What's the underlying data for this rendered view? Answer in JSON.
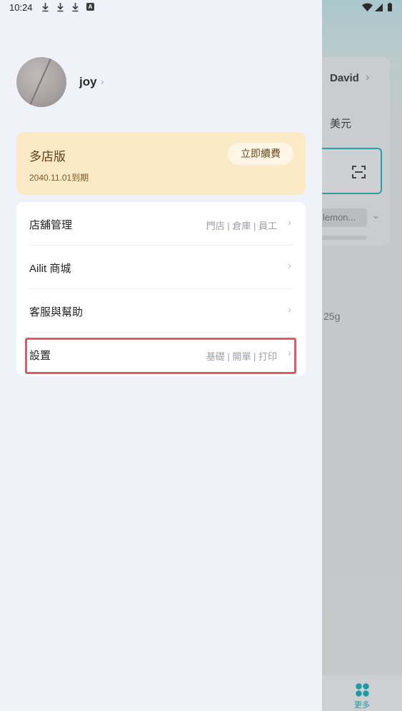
{
  "status_bar": {
    "time": "10:24",
    "icons": [
      "download-icon",
      "download-icon",
      "download-icon",
      "a-icon",
      "wifi-icon",
      "signal-icon",
      "battery-icon"
    ],
    "a_glyph": "A"
  },
  "background_app": {
    "user_name": "David",
    "currency": "美元",
    "dropdown_value": "lemon...",
    "weight_text": "25g",
    "bottom_nav_label": "更多",
    "accent_color": "#1e9aa3"
  },
  "drawer": {
    "profile": {
      "username": "joy",
      "chevron": "›"
    },
    "plan": {
      "name": "多店版",
      "expiry": "2040.11.01到期",
      "renew_label": "立即續費",
      "bg_color": "#fce9c5"
    },
    "menu": [
      {
        "label": "店舖管理",
        "sub": "門店 | 倉庫 | 員工",
        "chevron": "›"
      },
      {
        "label": "Ailit 商城",
        "sub": "",
        "chevron": "›"
      },
      {
        "label": "客服與幫助",
        "sub": "",
        "chevron": "›"
      },
      {
        "label": "設置",
        "sub": "基礎 | 開單 | 打印",
        "chevron": "›"
      }
    ],
    "highlight_color": "#e6566a"
  }
}
